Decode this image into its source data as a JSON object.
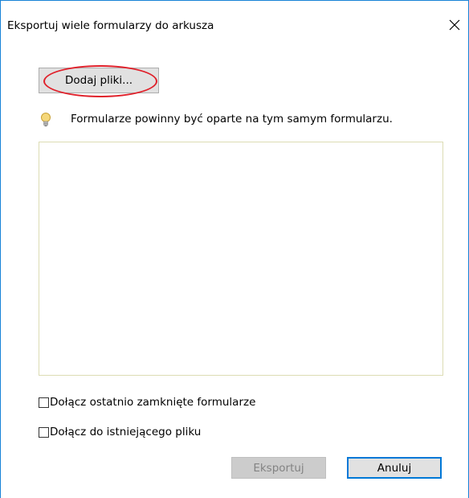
{
  "window": {
    "title": "Eksportuj wiele formularzy do arkusza",
    "close_glyph": "✕"
  },
  "actions": {
    "add_files_label": "Dodaj pliki...",
    "export_label": "Eksportuj",
    "cancel_label": "Anuluj"
  },
  "hint": {
    "icon": "lightbulb-icon",
    "text": "Formularze powinny być oparte na tym samym formularzu."
  },
  "file_list": {
    "items": []
  },
  "options": {
    "include_recent_label": "Dołącz ostatnio zamknięte formularze",
    "include_recent_checked": false,
    "append_existing_label": "Dołącz do istniejącego pliku",
    "append_existing_checked": false
  },
  "colors": {
    "accent": "#0078d7",
    "highlight_oval": "#e0202a",
    "window_border": "#1883d7"
  }
}
